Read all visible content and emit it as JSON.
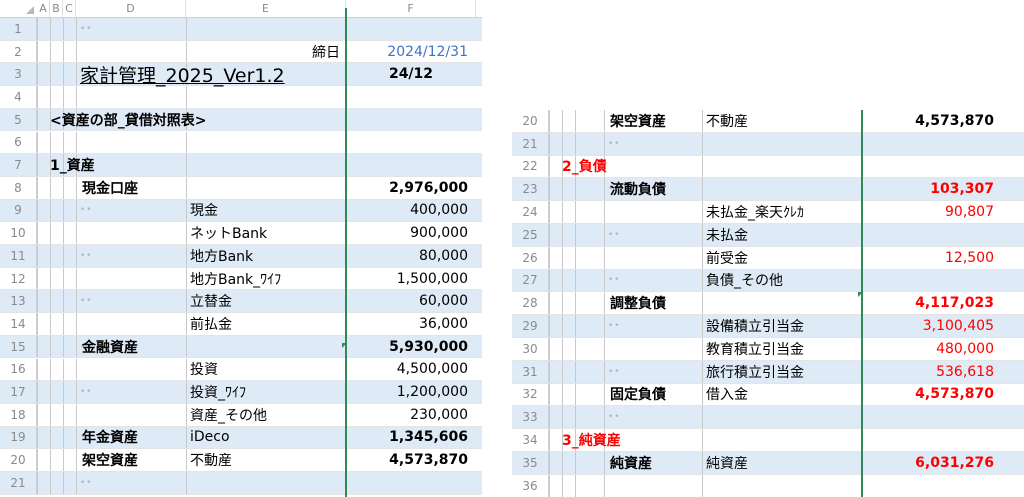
{
  "left": {
    "col_headers": [
      "A",
      "B",
      "C",
      "D",
      "E",
      "F"
    ],
    "rows": [
      {
        "n": "1"
      },
      {
        "n": "2",
        "e": "締日",
        "f": "2024/12/31"
      },
      {
        "n": "3",
        "title": "家計管理_2025_Ver1.2",
        "f": "24/12"
      },
      {
        "n": "4"
      },
      {
        "n": "5",
        "section": "<資産の部_貸借対照表>"
      },
      {
        "n": "6"
      },
      {
        "n": "7",
        "cat": "1_資産"
      },
      {
        "n": "8",
        "d": "現金口座",
        "f": "2,976,000"
      },
      {
        "n": "9",
        "e": "現金",
        "f": "400,000"
      },
      {
        "n": "10",
        "e": "ネットBank",
        "f": "900,000"
      },
      {
        "n": "11",
        "e": "地方Bank",
        "f": "80,000"
      },
      {
        "n": "12",
        "e": "地方Bank_ﾜｲﾌ",
        "f": "1,500,000"
      },
      {
        "n": "13",
        "e": "立替金",
        "f": "60,000"
      },
      {
        "n": "14",
        "e": "前払金",
        "f": "36,000"
      },
      {
        "n": "15",
        "d": "金融資産",
        "f": "5,930,000"
      },
      {
        "n": "16",
        "e": "投資",
        "f": "4,500,000"
      },
      {
        "n": "17",
        "e": "投資_ﾜｲﾌ",
        "f": "1,200,000"
      },
      {
        "n": "18",
        "e": "資産_その他",
        "f": "230,000"
      },
      {
        "n": "19",
        "d": "年金資産",
        "e": "iDeco",
        "f": "1,345,606"
      },
      {
        "n": "20",
        "d": "架空資産",
        "e": "不動産",
        "f": "4,573,870"
      },
      {
        "n": "21"
      }
    ]
  },
  "right": {
    "rows": [
      {
        "n": "20",
        "d": "架空資産",
        "e": "不動産",
        "f": "4,573,870"
      },
      {
        "n": "21"
      },
      {
        "n": "22",
        "cat": "2_負債"
      },
      {
        "n": "23",
        "d": "流動負債",
        "f": "103,307"
      },
      {
        "n": "24",
        "e": "未払金_楽天ｸﾚｶ",
        "f": "90,807"
      },
      {
        "n": "25",
        "e": "未払金"
      },
      {
        "n": "26",
        "e": "前受金",
        "f": "12,500"
      },
      {
        "n": "27",
        "e": "負債_その他"
      },
      {
        "n": "28",
        "d": "調整負債",
        "f": "4,117,023"
      },
      {
        "n": "29",
        "e": "設備積立引当金",
        "f": "3,100,405"
      },
      {
        "n": "30",
        "e": "教育積立引当金",
        "f": "480,000"
      },
      {
        "n": "31",
        "e": "旅行積立引当金",
        "f": "536,618"
      },
      {
        "n": "32",
        "d": "固定負債",
        "e": "借入金",
        "f": "4,573,870"
      },
      {
        "n": "33"
      },
      {
        "n": "34",
        "cat": "3_純資産"
      },
      {
        "n": "35",
        "d": "純資産",
        "e": "純資産",
        "f": "6,031,276"
      },
      {
        "n": "36"
      }
    ]
  },
  "dots_symbol": "••",
  "colors": {
    "band": "#deebf7",
    "negative": "#ff0000",
    "date": "#4472c4",
    "active_border": "#2e8b57"
  }
}
